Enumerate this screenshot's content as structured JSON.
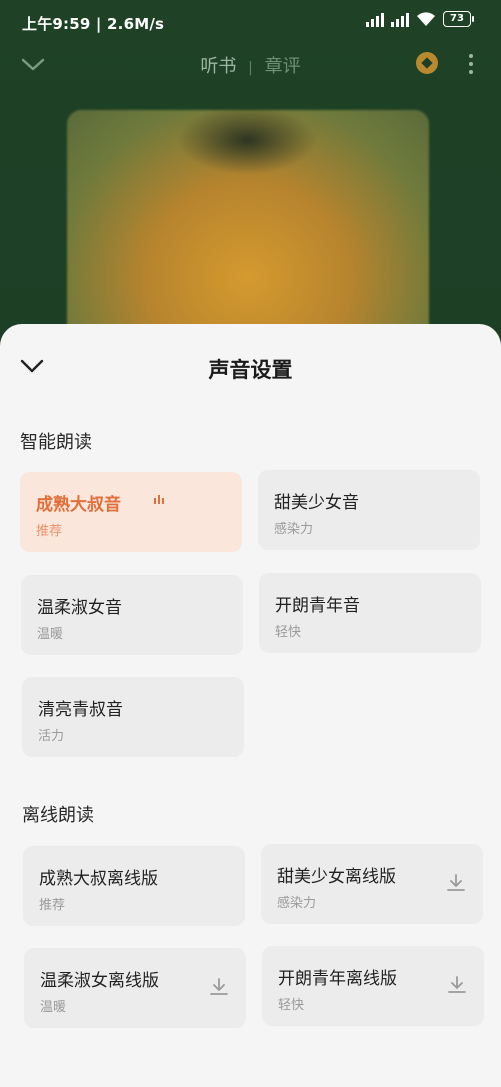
{
  "status": {
    "time": "上午9:59 | 2.6M/s",
    "battery": "73"
  },
  "player": {
    "tabs": [
      "听书",
      "章评"
    ],
    "tab_separator": "|"
  },
  "sheet": {
    "title": "声音设置",
    "smart_section": {
      "title": "智能朗读",
      "voices": [
        {
          "name": "成熟大叔音",
          "desc": "推荐",
          "selected": true
        },
        {
          "name": "甜美少女音",
          "desc": "感染力"
        },
        {
          "name": "温柔淑女音",
          "desc": "温暖"
        },
        {
          "name": "开朗青年音",
          "desc": "轻快"
        },
        {
          "name": "清亮青叔音",
          "desc": "活力"
        }
      ]
    },
    "offline_section": {
      "title": "离线朗读",
      "voices": [
        {
          "name": "成熟大叔离线版",
          "desc": "推荐"
        },
        {
          "name": "甜美少女离线版",
          "desc": "感染力",
          "download": true
        },
        {
          "name": "温柔淑女离线版",
          "desc": "温暖",
          "download": true
        },
        {
          "name": "开朗青年离线版",
          "desc": "轻快",
          "download": true
        }
      ]
    }
  },
  "colors": {
    "accent": "#e0703b",
    "selected_bg": "#fbe6dc",
    "card_bg": "#ececec",
    "player_bg": "#1e4228"
  }
}
